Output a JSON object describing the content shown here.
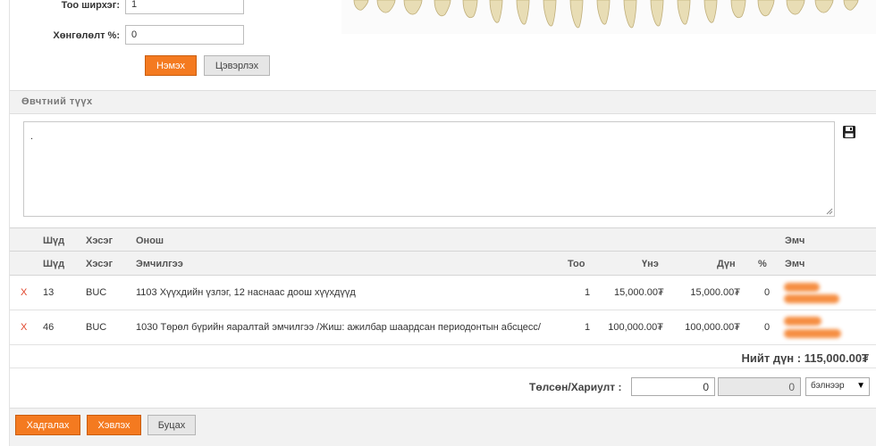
{
  "form": {
    "qty_label": "Тоо ширхэг:",
    "qty_value": "1",
    "discount_label": "Хөнгөлөлт %:",
    "discount_value": "0",
    "add_button": "Нэмэх",
    "clear_button": "Цэвэрлэх"
  },
  "history": {
    "title": "Өвчтний түүх",
    "text": "."
  },
  "table": {
    "header1": {
      "seq": "Шүд",
      "part": "Хэсэг",
      "diagnosis": "Онош",
      "doctor": "Эмч"
    },
    "header2": {
      "seq": "Шүд",
      "part": "Хэсэг",
      "treatment": "Эмчилгээ",
      "qty": "Тоо",
      "price": "Үнэ",
      "amount": "Дүн",
      "pct": "%",
      "doctor": "Эмч"
    },
    "rows": [
      {
        "del": "X",
        "tooth": "13",
        "part": "BUC",
        "treatment": "1103 Хүүхдийн үзлэг, 12 наснаас доош хүүхдүүд",
        "qty": "1",
        "price": "15,000.00₮",
        "amount": "15,000.00₮",
        "pct": "0"
      },
      {
        "del": "X",
        "tooth": "46",
        "part": "BUC",
        "treatment": "1030 Төрөл бүрийн яаралтай эмчилгээ /Жиш: ажилбар шаардсан периодонтын абсцесс/",
        "qty": "1",
        "price": "100,000.00₮",
        "amount": "100,000.00₮",
        "pct": "0"
      }
    ]
  },
  "total": "Нийт дүн : 115,000.00₮",
  "payment": {
    "label": "Төлсөн/Хариулт :",
    "paid": "0",
    "change": "0",
    "method": "бэлнээр"
  },
  "footer": {
    "save": "Хадгалах",
    "print": "Хэвлэх",
    "back": "Буцах"
  },
  "colors": {
    "accent": "#f47a20",
    "delete": "#e0442a"
  }
}
